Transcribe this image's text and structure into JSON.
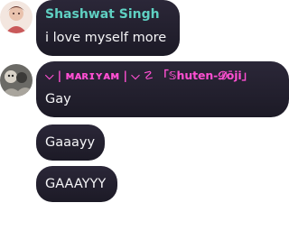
{
  "messages": [
    {
      "sender": "Shashwat Singh",
      "text": "i love myself more"
    },
    {
      "sender": "⌵ | ᴍᴀʀɪʏᴀᴍ | ⌵ ☡ 「𝕊huten-𝓓ōji」",
      "text": "Gay"
    },
    {
      "sender": "",
      "text": "Gaaayy"
    },
    {
      "sender": "",
      "text": "GAAAYYY"
    }
  ],
  "colors": {
    "bubble": "#1e1b2b",
    "sender_1": "#5fd0c2",
    "sender_2": "#ff4fd2"
  }
}
